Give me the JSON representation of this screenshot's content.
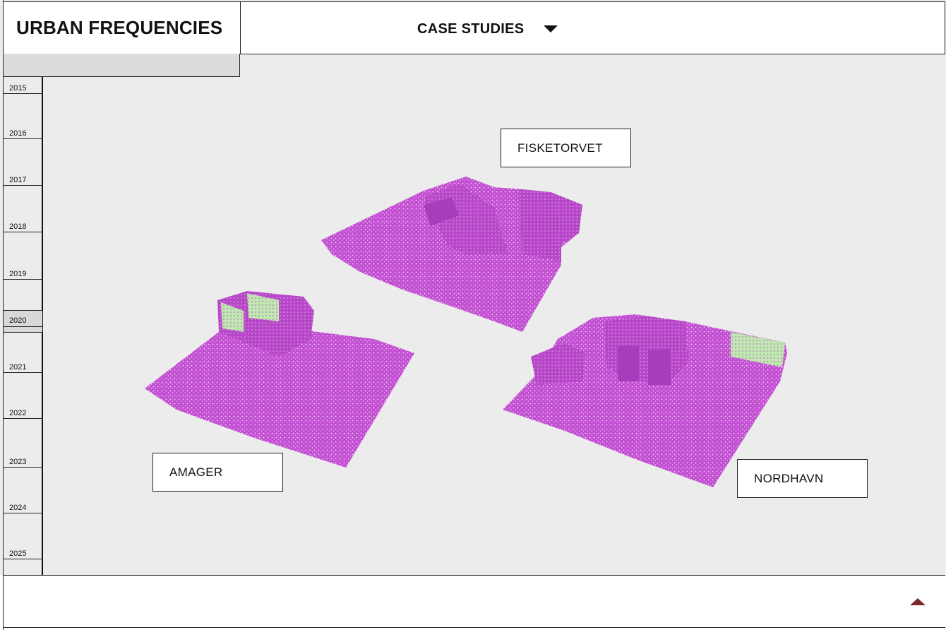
{
  "header": {
    "brand": "URBAN FREQUENCIES",
    "menu_label": "CASE STUDIES",
    "menu_icon": "caret-down-icon"
  },
  "timeline": {
    "years": [
      "2015",
      "2016",
      "2017",
      "2018",
      "2019",
      "2020",
      "2021",
      "2022",
      "2023",
      "2024",
      "2025"
    ],
    "selected": "2020"
  },
  "sites": {
    "fisketorvet": "FISKETORVET",
    "amager": "AMAGER",
    "nordhavn": "NORDHAVN"
  },
  "colors": {
    "point_cloud_primary": "#c34fd3",
    "point_cloud_highlight": "#bfe8b0",
    "up_arrow": "#7a2b2b"
  },
  "footer": {
    "up_icon": "caret-up-icon"
  }
}
